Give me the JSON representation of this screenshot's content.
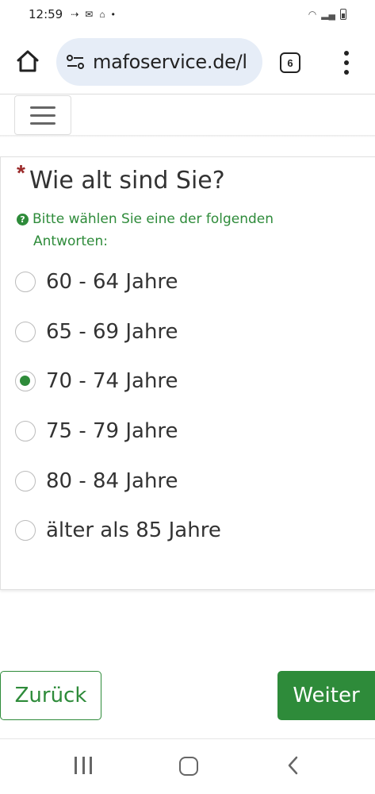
{
  "status_bar": {
    "time": "12:59"
  },
  "browser": {
    "url": "mafoservice.de/l",
    "tab_count": "6"
  },
  "question": {
    "required_mark": "*",
    "title": "Wie alt sind Sie?",
    "help_line1": "Bitte wählen Sie eine der folgenden",
    "help_line2": "Antworten:",
    "help_icon": "?",
    "options": [
      {
        "label": "60 - 64 Jahre",
        "checked": false
      },
      {
        "label": "65 - 69 Jahre",
        "checked": false
      },
      {
        "label": "70 - 74 Jahre",
        "checked": true
      },
      {
        "label": "75 - 79 Jahre",
        "checked": false
      },
      {
        "label": "80 - 84 Jahre",
        "checked": false
      },
      {
        "label": "älter als 85 Jahre",
        "checked": false
      }
    ]
  },
  "buttons": {
    "back_label": "Zurück",
    "next_label": "Weiter"
  },
  "colors": {
    "accent": "#2e8b3a",
    "required": "#9b2a2a",
    "url_pill": "#e6edf7"
  },
  "icons": {
    "home": "home-icon",
    "site_settings": "tune-icon",
    "menu": "more-vert-icon",
    "nav": "hamburger-icon"
  }
}
